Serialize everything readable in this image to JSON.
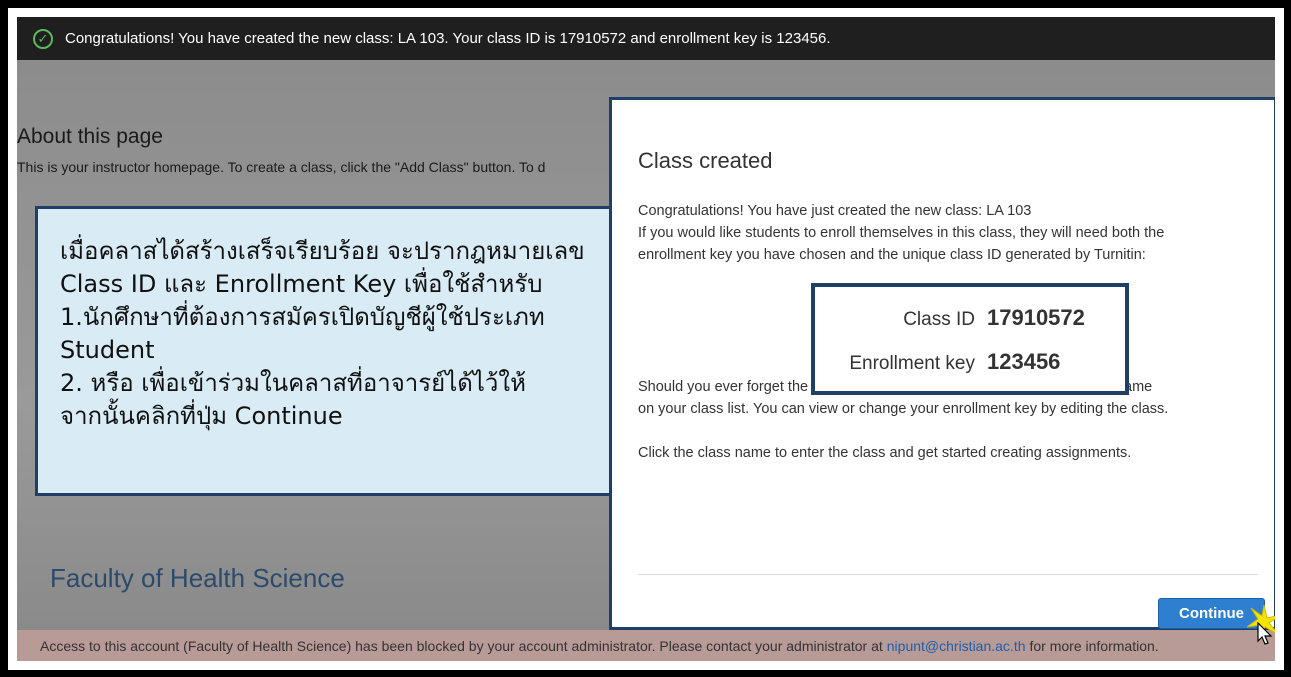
{
  "banner": {
    "message": "Congratulations! You have created the new class: LA 103. Your class ID is 17910572 and enrollment key is 123456."
  },
  "about": {
    "title": "About this page",
    "text": "This is your instructor homepage. To create a class, click the \"Add Class\" button. To d"
  },
  "faculty": "Faculty of Health Science",
  "callout": {
    "lines": [
      "เมื่อคลาสได้สร้างเสร็จเรียบร้อย จะปรากฎหมายเลข",
      "Class ID และ Enrollment Key เพื่อใช้สำหรับ",
      "1.นักศึกษาที่ต้องการสมัครเปิดบัญชีผู้ใช้ประเภท",
      "Student",
      "2. หรือ เพื่อเข้าร่วมในคลาสที่อาจารย์ได้ไว้ให้",
      "จากนั้นคลิกที่ปุ่ม Continue"
    ]
  },
  "modal": {
    "title": "Class created",
    "p1": "Congratulations! You have just created the new class: LA 103",
    "p2a": "If you would like students to enroll themselves in this class, they will need both the",
    "p2b": "enrollment key you have chosen and the unique class ID generated by Turnitin:",
    "class_id_label": "Class ID",
    "class_id_value": "17910572",
    "enroll_label": "Enrollment key",
    "enroll_value": "123456",
    "p3a": "Should you ever forget the class ID, it is the number to the left of the class name",
    "p3b": "on your class list. You can view or change your enrollment key by editing the class.",
    "p4": "Click the class name to enter the class and get started creating assignments.",
    "continue_label": "Continue"
  },
  "footer": {
    "text_before": "Access to this account (Faculty of Health Science) has been blocked by your account administrator. Please contact your administrator at",
    "email": "nipunt@christian.ac.th",
    "text_after": "for more information."
  },
  "icons": {
    "banner": "check-circle-icon",
    "cursor": "mouse-pointer-icon",
    "sparkle": "click-sparkle-icon"
  }
}
